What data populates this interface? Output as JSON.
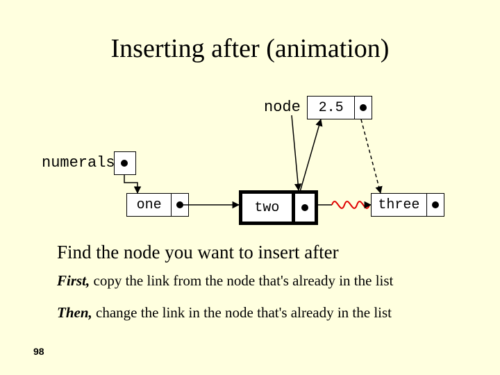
{
  "title": "Inserting after (animation)",
  "labels": {
    "node": "node",
    "numerals": "numerals"
  },
  "nodes": {
    "newnode": "2.5",
    "one": "one",
    "two": "two",
    "three": "three"
  },
  "text": {
    "line1": "Find the node you want to insert after",
    "line2_em": "First,",
    "line2_rest": " copy the link from the node that's already in the list",
    "line3_em": "Then,",
    "line3_rest": " change the link in the node that's already in the list"
  },
  "page": "98"
}
